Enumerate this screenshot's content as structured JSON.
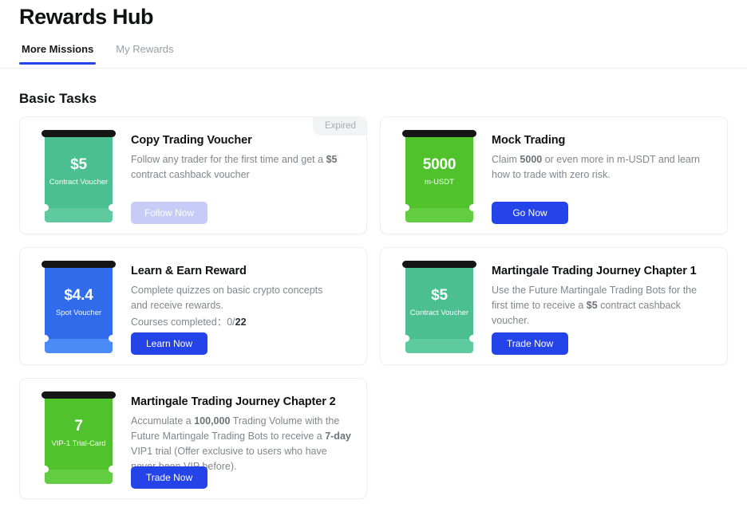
{
  "header": {
    "title": "Rewards Hub",
    "tabs": [
      {
        "label": "More Missions",
        "active": true
      },
      {
        "label": "My Rewards",
        "active": false
      }
    ]
  },
  "section": {
    "title": "Basic Tasks"
  },
  "colors": {
    "accent_blue": "#2443e8",
    "disabled_blue": "#c6ccf6",
    "voucher_green": "#4cbf92",
    "voucher_green_stub": "#5fc99f",
    "voucher_bright_green": "#4fc22c",
    "voucher_bright_green_stub": "#62cd41",
    "voucher_blue": "#2f6beb",
    "voucher_blue_stub": "#4a8bf5",
    "badge_gray": "#f2f3f5",
    "text_muted": "#82858d"
  },
  "cards": [
    {
      "title": "Copy Trading Voucher",
      "desc_parts": [
        {
          "text": "Follow any trader for the first time and get a ",
          "bold": false
        },
        {
          "text": "$5",
          "bold": true
        },
        {
          "text": " contract cashback voucher",
          "bold": false
        }
      ],
      "badge": "Expired",
      "button": {
        "label": "Follow Now",
        "state": "disabled"
      },
      "voucher": {
        "amount": "$5",
        "label": "Contract Voucher",
        "body_color": "#4cbf92",
        "stub_color": "#5fc99f"
      }
    },
    {
      "title": "Mock Trading",
      "desc_parts": [
        {
          "text": "Claim ",
          "bold": false
        },
        {
          "text": "5000",
          "bold": true
        },
        {
          "text": " or even more in m-USDT and learn how to trade with zero risk.",
          "bold": false
        }
      ],
      "badge": null,
      "button": {
        "label": "Go Now",
        "state": "primary"
      },
      "voucher": {
        "amount": "5000",
        "label": "m-USDT",
        "body_color": "#4fc22c",
        "stub_color": "#62cd41"
      }
    },
    {
      "title": "Learn & Earn Reward",
      "desc_parts": [
        {
          "text": "Complete quizzes on basic crypto concepts and receive rewards.",
          "bold": false
        }
      ],
      "progress": {
        "label": "Courses completed：",
        "completed": "0/",
        "total": "22"
      },
      "badge": null,
      "button": {
        "label": "Learn Now",
        "state": "primary"
      },
      "voucher": {
        "amount": "$4.4",
        "label": "Spot Voucher",
        "body_color": "#2f6beb",
        "stub_color": "#4a8bf5"
      }
    },
    {
      "title": "Martingale Trading Journey Chapter 1",
      "desc_parts": [
        {
          "text": "Use the Future Martingale Trading Bots for the first time to receive a ",
          "bold": false
        },
        {
          "text": "$5",
          "bold": true
        },
        {
          "text": " contract cashback voucher.",
          "bold": false
        }
      ],
      "badge": null,
      "button": {
        "label": "Trade Now",
        "state": "primary"
      },
      "voucher": {
        "amount": "$5",
        "label": "Contract Voucher",
        "body_color": "#4cbf92",
        "stub_color": "#5fc99f"
      }
    },
    {
      "title": "Martingale Trading Journey Chapter 2",
      "desc_parts": [
        {
          "text": "Accumulate a ",
          "bold": false
        },
        {
          "text": "100,000",
          "bold": true
        },
        {
          "text": " Trading Volume with the Future Martingale Trading Bots to receive a ",
          "bold": false
        },
        {
          "text": "7-day",
          "bold": true
        },
        {
          "text": " VIP1 trial (Offer exclusive to users who have never been VIP before).",
          "bold": false
        }
      ],
      "badge": null,
      "button": {
        "label": "Trade Now",
        "state": "primary"
      },
      "voucher": {
        "amount": "7",
        "label": "VIP-1 Trial-Card",
        "body_color": "#4fc22c",
        "stub_color": "#62cd41"
      }
    }
  ]
}
